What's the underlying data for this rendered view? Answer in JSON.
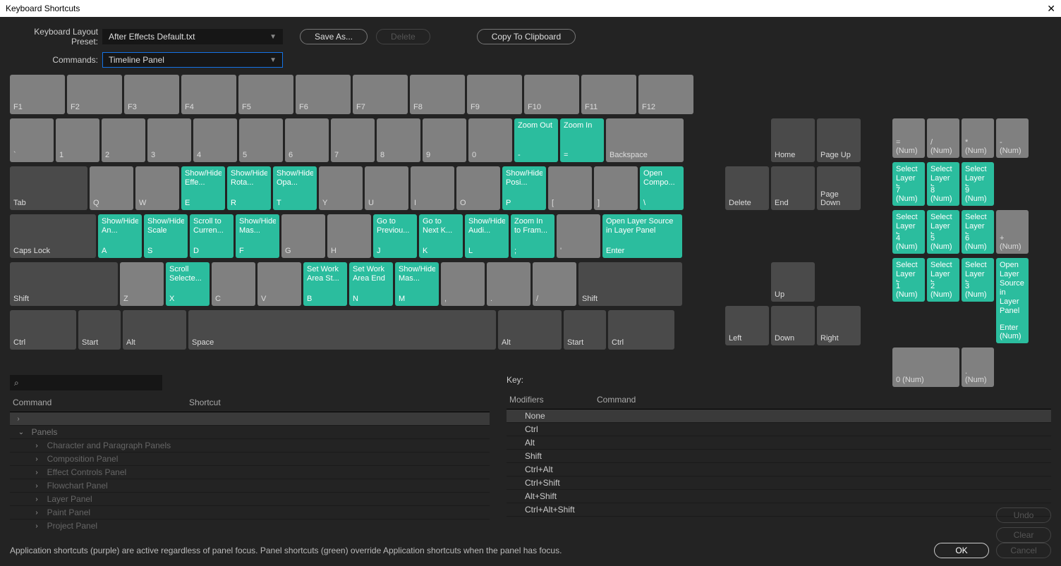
{
  "title": "Keyboard Shortcuts",
  "labels": {
    "layout_preset": "Keyboard Layout Preset:",
    "commands": "Commands:",
    "save_as": "Save As...",
    "delete": "Delete",
    "copy_clipboard": "Copy To Clipboard",
    "key": "Key:",
    "command_col": "Command",
    "shortcut_col": "Shortcut",
    "modifiers_col": "Modifiers",
    "command_col2": "Command",
    "undo": "Undo",
    "clear": "Clear",
    "ok": "OK",
    "cancel": "Cancel",
    "footer_hint": "Application shortcuts (purple) are active regardless of panel focus. Panel shortcuts (green) override Application shortcuts when the panel has focus."
  },
  "dropdowns": {
    "preset": "After Effects Default.txt",
    "commands": "Timeline Panel"
  },
  "frow": [
    "F1",
    "F2",
    "F3",
    "F4",
    "F5",
    "F6",
    "F7",
    "F8",
    "F9",
    "F10",
    "F11",
    "F12"
  ],
  "row1": {
    "keys": [
      "`",
      "1",
      "2",
      "3",
      "4",
      "5",
      "6",
      "7",
      "8",
      "9",
      "0",
      "-",
      "=",
      "Backspace"
    ],
    "actions": {
      "-": "Zoom Out",
      "=": "Zoom In"
    }
  },
  "row2": {
    "first": "Tab",
    "keys": [
      "Q",
      "W",
      "E",
      "R",
      "T",
      "Y",
      "U",
      "I",
      "O",
      "P",
      "[",
      "]",
      "\\"
    ],
    "actions": {
      "E": "Show/Hide Effe...",
      "R": "Show/Hide Rota...",
      "T": "Show/Hide Opa...",
      "P": "Show/Hide Posi...",
      "\\": "Open Compo..."
    }
  },
  "row3": {
    "first": "Caps Lock",
    "keys": [
      "A",
      "S",
      "D",
      "F",
      "G",
      "H",
      "J",
      "K",
      "L",
      ";",
      "'",
      "Enter"
    ],
    "actions": {
      "A": "Show/Hide An...",
      "S": "Show/Hide Scale",
      "D": "Scroll to Curren...",
      "F": "Show/Hide Mas...",
      "J": "Go to Previou...",
      "K": "Go to Next K...",
      "L": "Show/Hide Audi...",
      ";": "Zoom In to Fram...",
      "Enter": "Open Layer Source in Layer Panel"
    }
  },
  "row4": {
    "first": "Shift",
    "keys": [
      "Z",
      "X",
      "C",
      "V",
      "B",
      "N",
      "M",
      ",",
      ".",
      "/",
      "Shift"
    ],
    "actions": {
      "X": "Scroll Selecte...",
      "B": "Set Work Area St...",
      "N": "Set Work Area End",
      "M": "Show/Hide Mas..."
    }
  },
  "row5": [
    "Ctrl",
    "Start",
    "Alt",
    "Space",
    "Alt",
    "Start",
    "Ctrl"
  ],
  "nav_top": [
    [
      "",
      "Home",
      "Page Up"
    ],
    [
      "Delete",
      "End",
      "Page Down"
    ]
  ],
  "nav_single": "Up",
  "nav_bottom": [
    "Left",
    "Down",
    "Right"
  ],
  "num_top": [
    "= (Num)",
    "/ (Num)",
    "* (Num)",
    "- (Num)"
  ],
  "num_rows": [
    [
      {
        "k": "7 (Num)",
        "a": "Select Layer b..."
      },
      {
        "k": "8 (Num)",
        "a": "Select Layer b..."
      },
      {
        "k": "9 (Num)",
        "a": "Select Layer b..."
      },
      {
        "k": "",
        "a": ""
      }
    ],
    [
      {
        "k": "4 (Num)",
        "a": "Select Layer b..."
      },
      {
        "k": "5 (Num)",
        "a": "Select Layer b..."
      },
      {
        "k": "6 (Num)",
        "a": "Select Layer b..."
      },
      {
        "k": "+ (Num)",
        "a": ""
      }
    ],
    [
      {
        "k": "1 (Num)",
        "a": "Select Layer b..."
      },
      {
        "k": "2 (Num)",
        "a": "Select Layer b..."
      },
      {
        "k": "3 (Num)",
        "a": "Select Layer b..."
      },
      {
        "k": "Enter (Num)",
        "a": "Open Layer Source in Layer Panel"
      }
    ],
    [
      {
        "k": "0 (Num)",
        "a": ""
      },
      {
        "k": ". (Num)",
        "a": ""
      }
    ]
  ],
  "panel_tree": {
    "root": "Panels",
    "children": [
      "Character and Paragraph Panels",
      "Composition Panel",
      "Effect Controls Panel",
      "Flowchart Panel",
      "Layer Panel",
      "Paint Panel",
      "Project Panel"
    ]
  },
  "modifiers": [
    "None",
    "Ctrl",
    "Alt",
    "Shift",
    "Ctrl+Alt",
    "Ctrl+Shift",
    "Alt+Shift",
    "Ctrl+Alt+Shift"
  ]
}
